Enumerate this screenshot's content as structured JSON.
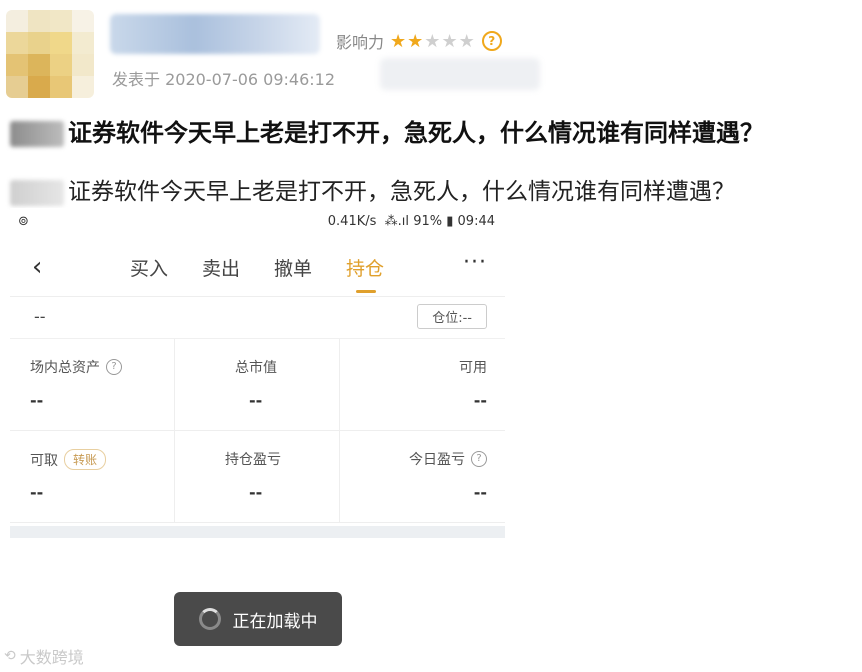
{
  "post": {
    "influence_label": "影响力",
    "stars_filled": 2,
    "stars_total": 5,
    "posted_at": "发表于 2020-07-06 09:46:12",
    "title": "证券软件今天早上老是打不开，急死人，什么情况谁有同样遭遇？",
    "body": "证券软件今天早上老是打不开，急死人，什么情况谁有同样遭遇？"
  },
  "phone": {
    "status": {
      "speed": "0.41K/s",
      "battery": "91%",
      "time": "09:44"
    },
    "nav": {
      "tabs": [
        "买入",
        "卖出",
        "撤单",
        "持仓"
      ],
      "active_tab": "持仓",
      "more": "···"
    },
    "position_row": {
      "value": "--",
      "button": "仓位:--"
    },
    "cells": [
      {
        "label": "场内总资产",
        "value": "--",
        "help": true
      },
      {
        "label": "总市值",
        "value": "--"
      },
      {
        "label": "可用",
        "value": "--"
      },
      {
        "label": "可取",
        "value": "--",
        "tag": "转账"
      },
      {
        "label": "持仓盈亏",
        "value": "--"
      },
      {
        "label": "今日盈亏",
        "value": "--",
        "help": true
      }
    ]
  },
  "toast": {
    "text": "正在加载中"
  },
  "watermark": {
    "text": "大数跨境"
  },
  "colors": {
    "accent": "#e0a02c",
    "star": "#f0a81c",
    "toast_bg": "#4a4a4a"
  }
}
